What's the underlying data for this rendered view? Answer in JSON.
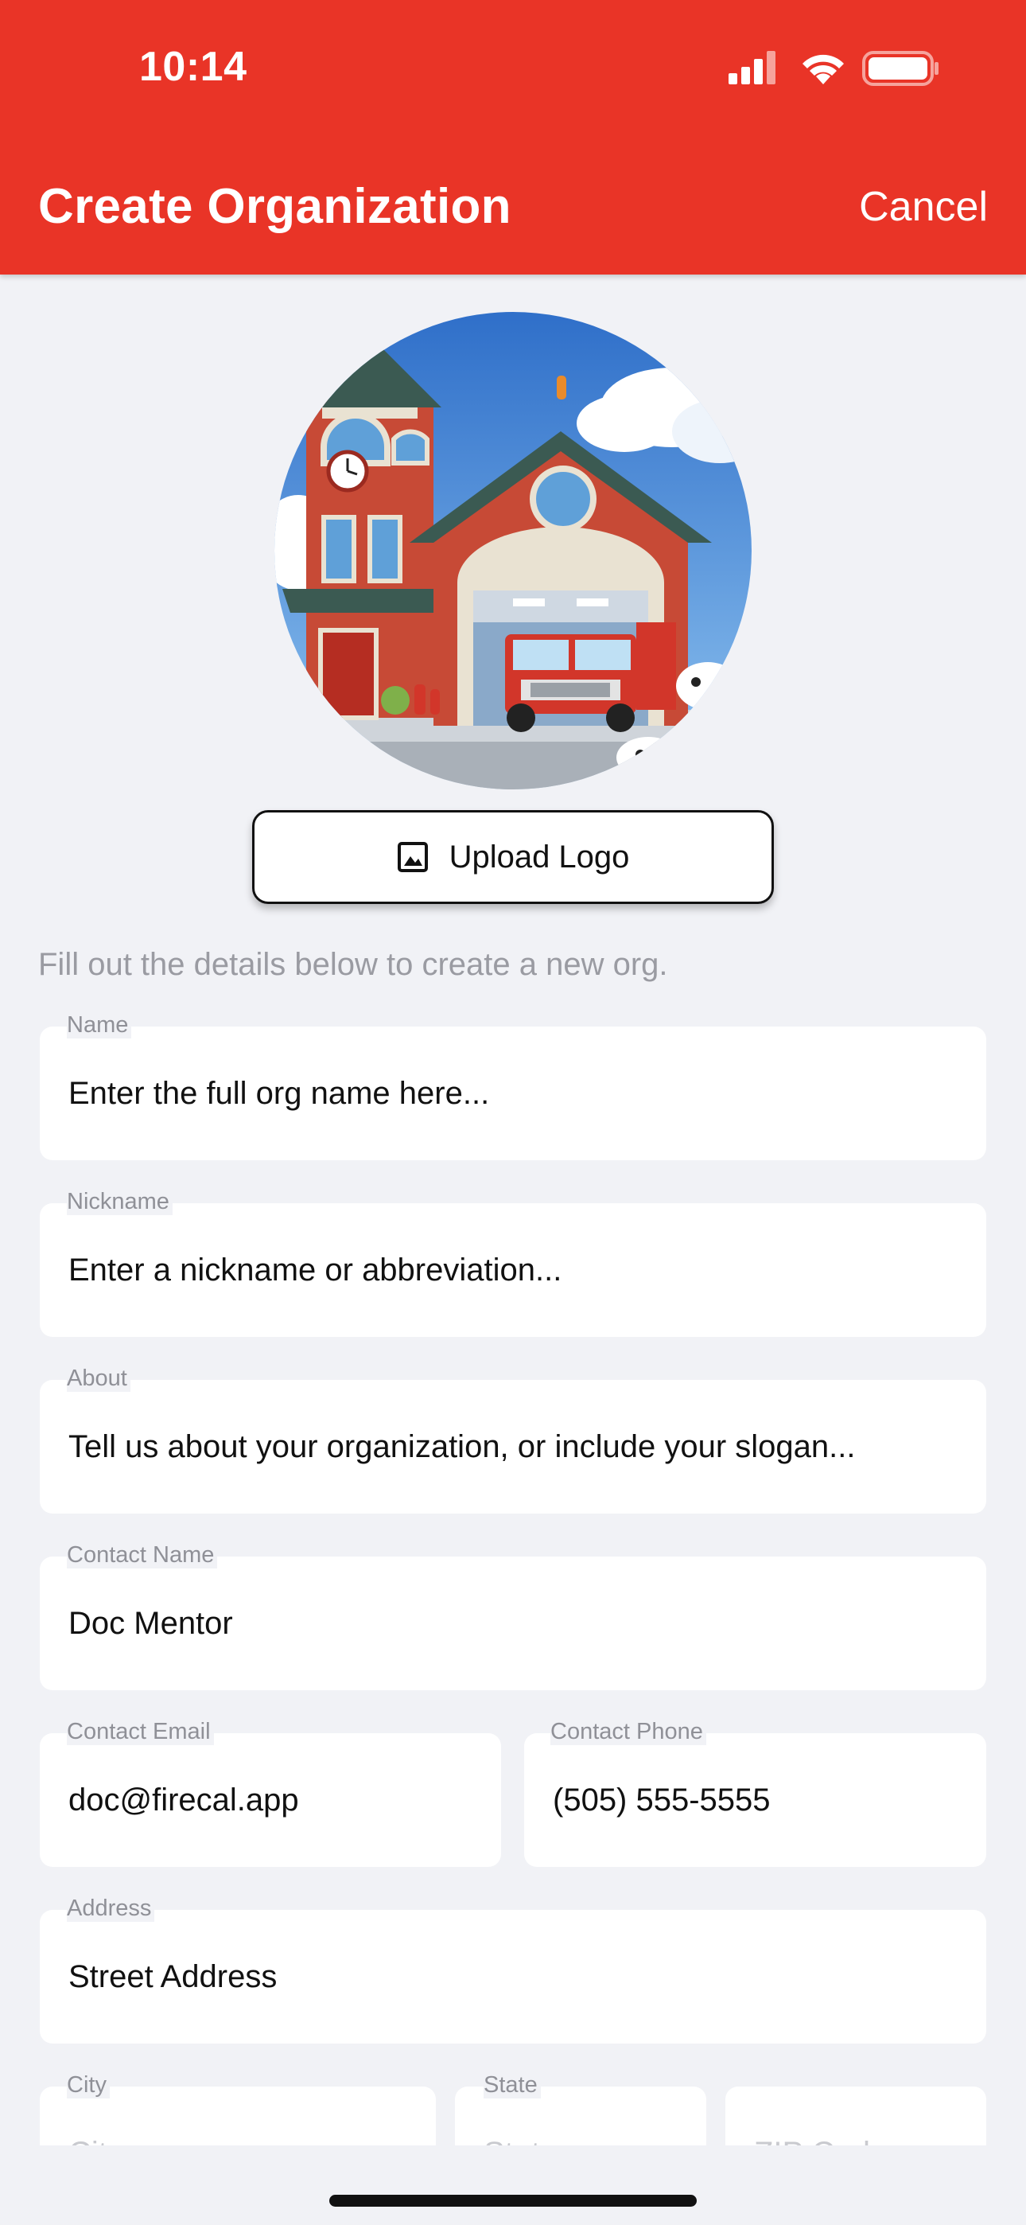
{
  "status_bar": {
    "time": "10:14"
  },
  "header": {
    "title": "Create Organization",
    "cancel_label": "Cancel"
  },
  "logo": {
    "upload_label": "Upload Logo"
  },
  "instructions": "Fill out the details below to create a new org.",
  "fields": {
    "name": {
      "label": "Name",
      "placeholder": "Enter the full org name here..."
    },
    "nickname": {
      "label": "Nickname",
      "placeholder": "Enter a nickname or abbreviation..."
    },
    "about": {
      "label": "About",
      "placeholder": "Tell us about your organization, or include your slogan..."
    },
    "contact_name": {
      "label": "Contact Name",
      "value": "Doc Mentor"
    },
    "contact_email": {
      "label": "Contact Email",
      "value": "doc@firecal.app"
    },
    "contact_phone": {
      "label": "Contact Phone",
      "value": "(505) 555-5555"
    },
    "address": {
      "label": "Address",
      "placeholder": "Street Address"
    },
    "city": {
      "label": "City",
      "placeholder": "City"
    },
    "state": {
      "label": "State",
      "placeholder": "State"
    },
    "zip": {
      "placeholder": "ZIP Code"
    }
  },
  "colors": {
    "brand": "#e93427",
    "background": "#f1f2f6"
  }
}
